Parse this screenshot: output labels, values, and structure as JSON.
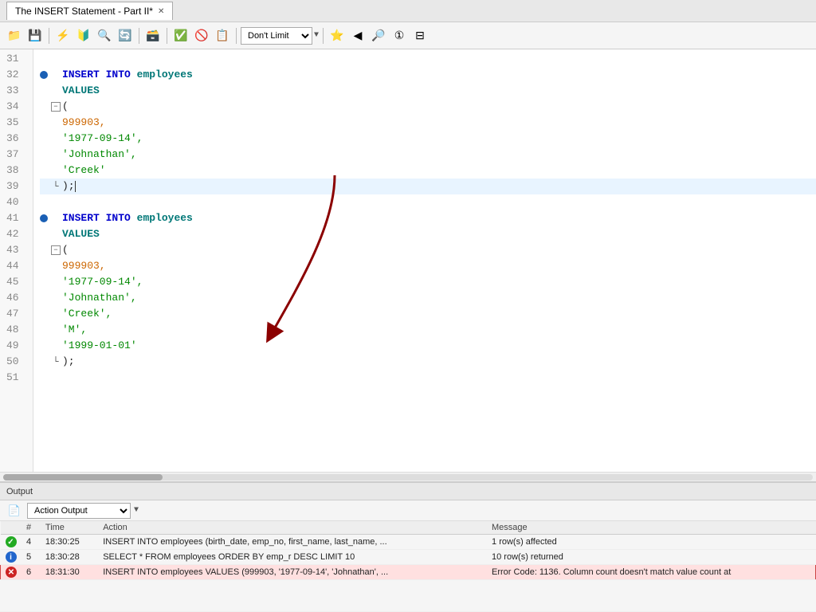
{
  "title_bar": {
    "tab_label": "The INSERT Statement - Part II*",
    "close_symbol": "✕"
  },
  "toolbar": {
    "dont_limit_label": "Don't Limit",
    "dropdown_arrow": "▼"
  },
  "editor": {
    "lines": [
      {
        "num": "31",
        "content": "",
        "type": "empty",
        "has_dot": false,
        "highlighted": false
      },
      {
        "num": "32",
        "content": "INSERT INTO employees",
        "type": "insert_into",
        "has_dot": true,
        "highlighted": false
      },
      {
        "num": "33",
        "content": "VALUES",
        "type": "values",
        "has_dot": false,
        "highlighted": false
      },
      {
        "num": "34",
        "content": "(",
        "type": "fold_open",
        "has_dot": false,
        "highlighted": false
      },
      {
        "num": "35",
        "content": "999903,",
        "type": "value_orange",
        "has_dot": false,
        "highlighted": false
      },
      {
        "num": "36",
        "content": "'1977-09-14',",
        "type": "value_green",
        "has_dot": false,
        "highlighted": false
      },
      {
        "num": "37",
        "content": "'Johnathan',",
        "type": "value_green",
        "has_dot": false,
        "highlighted": false
      },
      {
        "num": "38",
        "content": "'Creek'",
        "type": "value_green",
        "has_dot": false,
        "highlighted": false
      },
      {
        "num": "39",
        "content": ");",
        "type": "close_paren",
        "has_dot": false,
        "highlighted": true
      },
      {
        "num": "40",
        "content": "",
        "type": "empty",
        "has_dot": false,
        "highlighted": false
      },
      {
        "num": "41",
        "content": "INSERT INTO employees",
        "type": "insert_into",
        "has_dot": true,
        "highlighted": false
      },
      {
        "num": "42",
        "content": "VALUES",
        "type": "values",
        "has_dot": false,
        "highlighted": false
      },
      {
        "num": "43",
        "content": "(",
        "type": "fold_open",
        "has_dot": false,
        "highlighted": false
      },
      {
        "num": "44",
        "content": "999903,",
        "type": "value_orange",
        "has_dot": false,
        "highlighted": false
      },
      {
        "num": "45",
        "content": "'1977-09-14',",
        "type": "value_green",
        "has_dot": false,
        "highlighted": false
      },
      {
        "num": "46",
        "content": "'Johnathan',",
        "type": "value_green",
        "has_dot": false,
        "highlighted": false
      },
      {
        "num": "47",
        "content": "'Creek',",
        "type": "value_green",
        "has_dot": false,
        "highlighted": false
      },
      {
        "num": "48",
        "content": "'M',",
        "type": "value_green",
        "has_dot": false,
        "highlighted": false
      },
      {
        "num": "49",
        "content": "'1999-01-01'",
        "type": "value_green",
        "has_dot": false,
        "highlighted": false
      },
      {
        "num": "50",
        "content": ");",
        "type": "close_paren",
        "has_dot": false,
        "highlighted": false
      },
      {
        "num": "51",
        "content": "",
        "type": "empty",
        "has_dot": false,
        "highlighted": false
      }
    ]
  },
  "output": {
    "section_label": "Output",
    "action_output_label": "Action Output",
    "dropdown_arrow": "▼",
    "columns": [
      "#",
      "Time",
      "Action",
      "Message"
    ],
    "rows": [
      {
        "status": "success",
        "num": "4",
        "time": "18:30:25",
        "action": "INSERT INTO employees (birth_date,  emp_no,  first_name,  last_name,  ...",
        "message": "1 row(s) affected"
      },
      {
        "status": "info",
        "num": "5",
        "time": "18:30:28",
        "action": "SELECT  * FROM    employees ORDER BY emp_r DESC LIMIT 10",
        "message": "10 row(s) returned"
      },
      {
        "status": "error",
        "num": "6",
        "time": "18:31:30",
        "action": "INSERT INTO employees VALUES (999903,   '1977-09-14',   'Johnathan',  ...",
        "message": "Error Code: 1136. Column count doesn't match value count at"
      }
    ]
  }
}
